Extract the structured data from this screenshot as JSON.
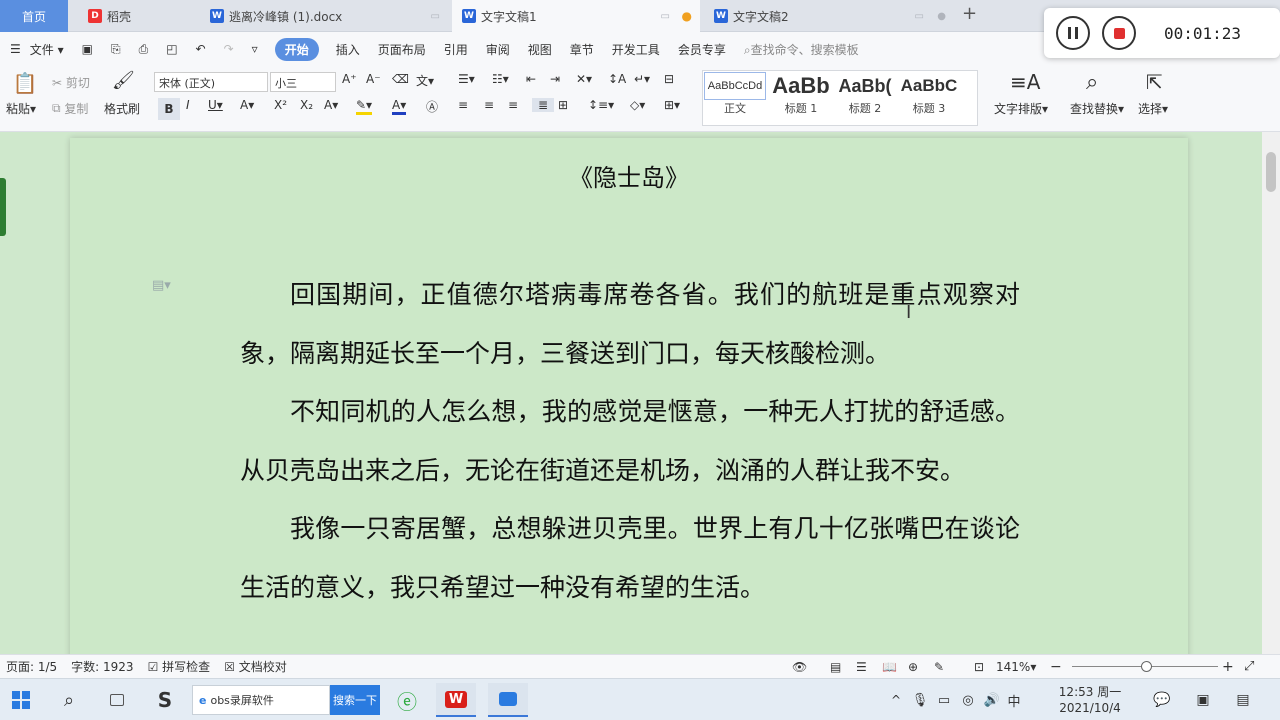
{
  "tabs": [
    {
      "label": "首页"
    },
    {
      "label": "稻壳"
    },
    {
      "label": "逃离冷峰镇 (1).docx"
    },
    {
      "label": "文字文稿1"
    },
    {
      "label": "文字文稿2"
    }
  ],
  "recorder": {
    "time": "00:01:23"
  },
  "menu": {
    "file": "文件",
    "items": [
      "开始",
      "插入",
      "页面布局",
      "引用",
      "审阅",
      "视图",
      "章节",
      "开发工具",
      "会员专享"
    ],
    "search_placeholder": "查找命令、搜索模板"
  },
  "ribbon": {
    "paste": "粘贴",
    "cut": "剪切",
    "copy": "复制",
    "format_painter": "格式刷",
    "font_name": "宋体 (正文)",
    "font_size": "小三",
    "styles": [
      {
        "sample": "AaBbCcDd",
        "name": "正文"
      },
      {
        "sample": "AaBb",
        "name": "标题 1"
      },
      {
        "sample": "AaBb(",
        "name": "标题 2"
      },
      {
        "sample": "AaBbC",
        "name": "标题 3"
      }
    ],
    "text_layout": "文字排版",
    "find_replace": "查找替换",
    "select": "选择"
  },
  "document": {
    "title": "《隐士岛》",
    "paragraphs": [
      "回国期间，正值德尔塔病毒席卷各省。我们的航班是重点观察对象，隔离期延长至一个月，三餐送到门口，每天核酸检测。",
      "不知同机的人怎么想，我的感觉是惬意，一种无人打扰的舒适感。从贝壳岛出来之后，无论在街道还是机场，汹涌的人群让我不安。",
      "我像一只寄居蟹，总想躲进贝壳里。世界上有几十亿张嘴巴在谈论生活的意义，我只希望过一种没有希望的生活。"
    ]
  },
  "status": {
    "page": "页面: 1/5",
    "words": "字数: 1923",
    "spell": "拼写检查",
    "proof": "文档校对",
    "zoom": "141%"
  },
  "taskbar": {
    "obs": "obs录屏软件",
    "search_btn": "搜索一下",
    "ime": "中",
    "time": "12:53 周一",
    "date": "2021/10/4"
  }
}
